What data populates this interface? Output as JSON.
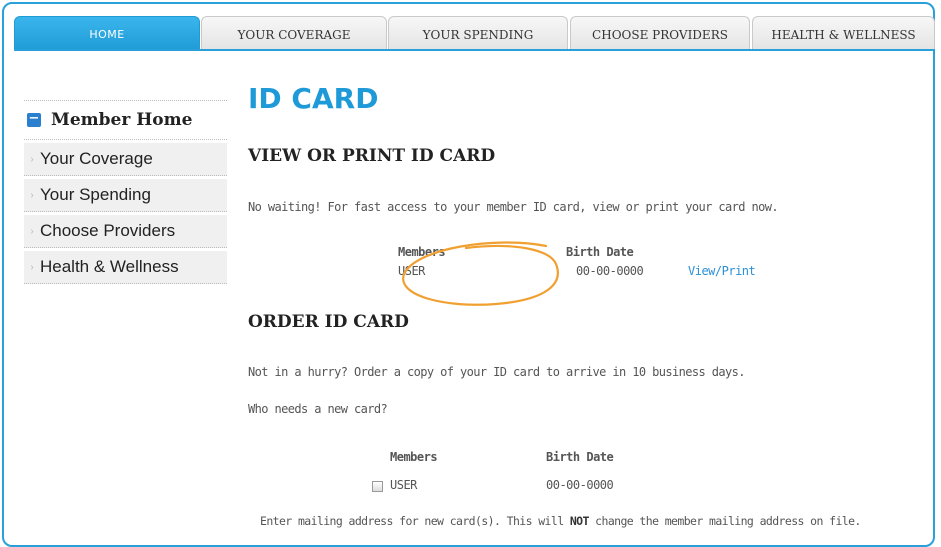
{
  "tabs": [
    {
      "label": "HOME",
      "active": true
    },
    {
      "label": "YOUR COVERAGE",
      "active": false
    },
    {
      "label": "YOUR SPENDING",
      "active": false
    },
    {
      "label": "CHOOSE PROVIDERS",
      "active": false
    },
    {
      "label": "HEALTH & WELLNESS",
      "active": false
    }
  ],
  "sidebar": {
    "header": "Member Home",
    "items": [
      {
        "label": "Your Coverage"
      },
      {
        "label": "Your Spending"
      },
      {
        "label": "Choose Providers"
      },
      {
        "label": "Health & Wellness"
      }
    ]
  },
  "main": {
    "title": "ID CARD",
    "view": {
      "heading": "VIEW OR PRINT ID CARD",
      "description": "No waiting! For fast access to your member ID card, view or print your card now.",
      "col_members": "Members",
      "col_birth": "Birth Date",
      "member": "USER",
      "birth_date": "00-00-0000",
      "action": "View/Print"
    },
    "order": {
      "heading": "ORDER ID CARD",
      "description": "Not in a hurry? Order a copy of your ID card to arrive in 10 business days.",
      "question": "Who needs a new card?",
      "col_members": "Members",
      "col_birth": "Birth Date",
      "member": "USER",
      "birth_date": "00-00-0000",
      "mailing_pre": "Enter mailing address for new card(s). This will ",
      "mailing_bold": "NOT",
      "mailing_post": " change the member mailing address on file."
    }
  },
  "colors": {
    "accent": "#2aa0db",
    "title_blue": "#1e9ad8",
    "link": "#2a8fd6",
    "annotation": "#f0a030"
  }
}
